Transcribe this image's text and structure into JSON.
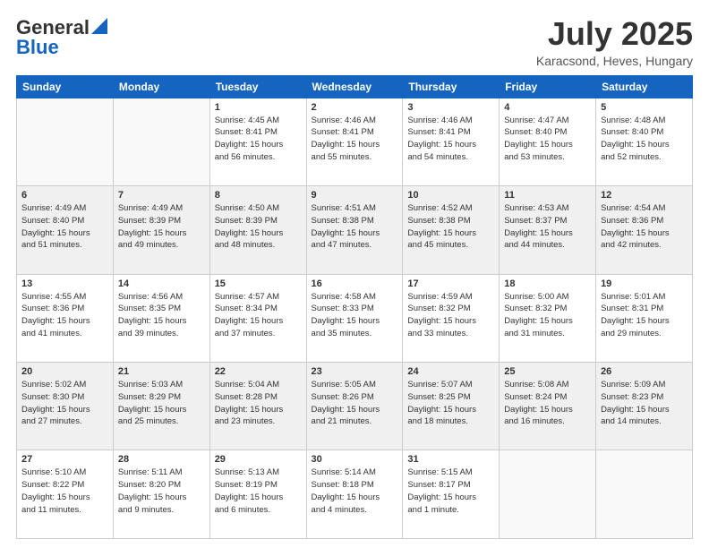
{
  "header": {
    "logo_line1": "General",
    "logo_line2": "Blue",
    "month": "July 2025",
    "location": "Karacsond, Heves, Hungary"
  },
  "weekdays": [
    "Sunday",
    "Monday",
    "Tuesday",
    "Wednesday",
    "Thursday",
    "Friday",
    "Saturday"
  ],
  "weeks": [
    [
      {
        "day": "",
        "info": ""
      },
      {
        "day": "",
        "info": ""
      },
      {
        "day": "1",
        "info": "Sunrise: 4:45 AM\nSunset: 8:41 PM\nDaylight: 15 hours\nand 56 minutes."
      },
      {
        "day": "2",
        "info": "Sunrise: 4:46 AM\nSunset: 8:41 PM\nDaylight: 15 hours\nand 55 minutes."
      },
      {
        "day": "3",
        "info": "Sunrise: 4:46 AM\nSunset: 8:41 PM\nDaylight: 15 hours\nand 54 minutes."
      },
      {
        "day": "4",
        "info": "Sunrise: 4:47 AM\nSunset: 8:40 PM\nDaylight: 15 hours\nand 53 minutes."
      },
      {
        "day": "5",
        "info": "Sunrise: 4:48 AM\nSunset: 8:40 PM\nDaylight: 15 hours\nand 52 minutes."
      }
    ],
    [
      {
        "day": "6",
        "info": "Sunrise: 4:49 AM\nSunset: 8:40 PM\nDaylight: 15 hours\nand 51 minutes."
      },
      {
        "day": "7",
        "info": "Sunrise: 4:49 AM\nSunset: 8:39 PM\nDaylight: 15 hours\nand 49 minutes."
      },
      {
        "day": "8",
        "info": "Sunrise: 4:50 AM\nSunset: 8:39 PM\nDaylight: 15 hours\nand 48 minutes."
      },
      {
        "day": "9",
        "info": "Sunrise: 4:51 AM\nSunset: 8:38 PM\nDaylight: 15 hours\nand 47 minutes."
      },
      {
        "day": "10",
        "info": "Sunrise: 4:52 AM\nSunset: 8:38 PM\nDaylight: 15 hours\nand 45 minutes."
      },
      {
        "day": "11",
        "info": "Sunrise: 4:53 AM\nSunset: 8:37 PM\nDaylight: 15 hours\nand 44 minutes."
      },
      {
        "day": "12",
        "info": "Sunrise: 4:54 AM\nSunset: 8:36 PM\nDaylight: 15 hours\nand 42 minutes."
      }
    ],
    [
      {
        "day": "13",
        "info": "Sunrise: 4:55 AM\nSunset: 8:36 PM\nDaylight: 15 hours\nand 41 minutes."
      },
      {
        "day": "14",
        "info": "Sunrise: 4:56 AM\nSunset: 8:35 PM\nDaylight: 15 hours\nand 39 minutes."
      },
      {
        "day": "15",
        "info": "Sunrise: 4:57 AM\nSunset: 8:34 PM\nDaylight: 15 hours\nand 37 minutes."
      },
      {
        "day": "16",
        "info": "Sunrise: 4:58 AM\nSunset: 8:33 PM\nDaylight: 15 hours\nand 35 minutes."
      },
      {
        "day": "17",
        "info": "Sunrise: 4:59 AM\nSunset: 8:32 PM\nDaylight: 15 hours\nand 33 minutes."
      },
      {
        "day": "18",
        "info": "Sunrise: 5:00 AM\nSunset: 8:32 PM\nDaylight: 15 hours\nand 31 minutes."
      },
      {
        "day": "19",
        "info": "Sunrise: 5:01 AM\nSunset: 8:31 PM\nDaylight: 15 hours\nand 29 minutes."
      }
    ],
    [
      {
        "day": "20",
        "info": "Sunrise: 5:02 AM\nSunset: 8:30 PM\nDaylight: 15 hours\nand 27 minutes."
      },
      {
        "day": "21",
        "info": "Sunrise: 5:03 AM\nSunset: 8:29 PM\nDaylight: 15 hours\nand 25 minutes."
      },
      {
        "day": "22",
        "info": "Sunrise: 5:04 AM\nSunset: 8:28 PM\nDaylight: 15 hours\nand 23 minutes."
      },
      {
        "day": "23",
        "info": "Sunrise: 5:05 AM\nSunset: 8:26 PM\nDaylight: 15 hours\nand 21 minutes."
      },
      {
        "day": "24",
        "info": "Sunrise: 5:07 AM\nSunset: 8:25 PM\nDaylight: 15 hours\nand 18 minutes."
      },
      {
        "day": "25",
        "info": "Sunrise: 5:08 AM\nSunset: 8:24 PM\nDaylight: 15 hours\nand 16 minutes."
      },
      {
        "day": "26",
        "info": "Sunrise: 5:09 AM\nSunset: 8:23 PM\nDaylight: 15 hours\nand 14 minutes."
      }
    ],
    [
      {
        "day": "27",
        "info": "Sunrise: 5:10 AM\nSunset: 8:22 PM\nDaylight: 15 hours\nand 11 minutes."
      },
      {
        "day": "28",
        "info": "Sunrise: 5:11 AM\nSunset: 8:20 PM\nDaylight: 15 hours\nand 9 minutes."
      },
      {
        "day": "29",
        "info": "Sunrise: 5:13 AM\nSunset: 8:19 PM\nDaylight: 15 hours\nand 6 minutes."
      },
      {
        "day": "30",
        "info": "Sunrise: 5:14 AM\nSunset: 8:18 PM\nDaylight: 15 hours\nand 4 minutes."
      },
      {
        "day": "31",
        "info": "Sunrise: 5:15 AM\nSunset: 8:17 PM\nDaylight: 15 hours\nand 1 minute."
      },
      {
        "day": "",
        "info": ""
      },
      {
        "day": "",
        "info": ""
      }
    ]
  ]
}
